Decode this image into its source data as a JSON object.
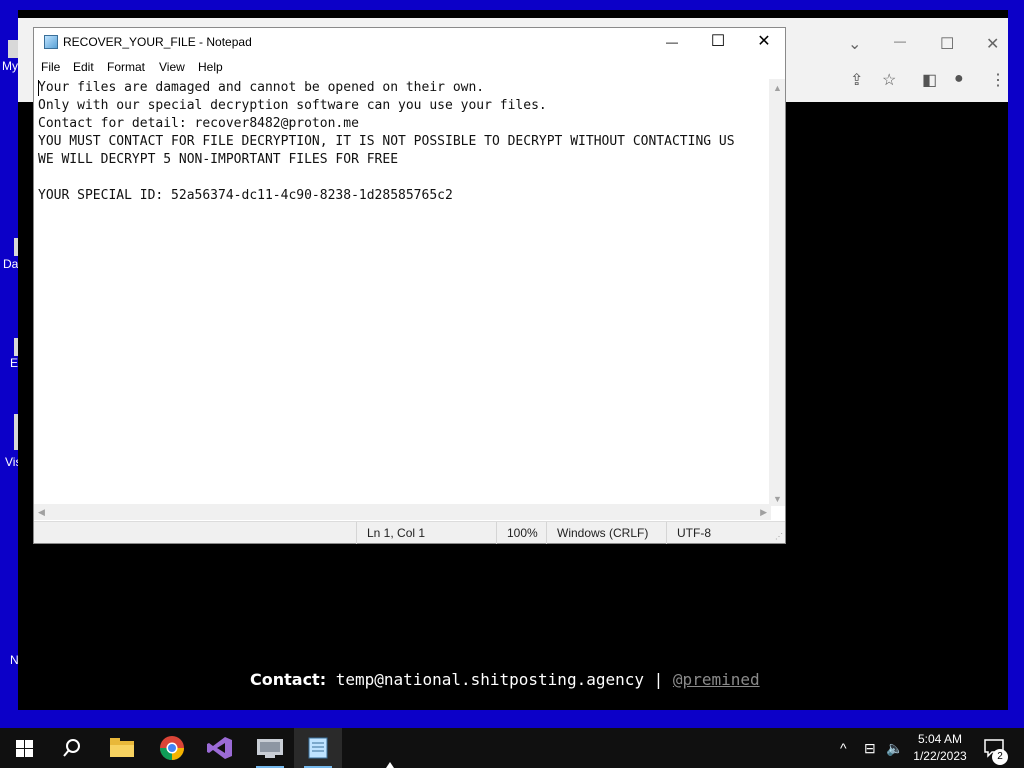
{
  "desktop": {
    "icons": [
      {
        "label": "My"
      },
      {
        "label": "Da"
      },
      {
        "label": "E"
      },
      {
        "label": "Vis"
      },
      {
        "label": "N"
      }
    ]
  },
  "browser": {
    "title_controls": {
      "chevron": "⌄",
      "minimize": "—",
      "maximize": "☐",
      "close": "✕"
    },
    "toolbar_icons": {
      "share": "⇪",
      "bookmark": "☆",
      "sidepanel": "◧",
      "profile": "●",
      "menu": "⋮"
    },
    "footer": {
      "label": "Contact:",
      "email": "temp@national.shitposting.agency",
      "separator": "|",
      "handle": "@premined"
    }
  },
  "notepad": {
    "title": "RECOVER_YOUR_FILE - Notepad",
    "controls": {
      "minimize": "—",
      "maximize": "☐",
      "close": "✕"
    },
    "menu": [
      "File",
      "Edit",
      "Format",
      "View",
      "Help"
    ],
    "lines": [
      "Your files are damaged and cannot be opened on their own.",
      "Only with our special decryption software can you use your files.",
      "Contact for detail: recover8482@proton.me",
      "YOU MUST CONTACT FOR FILE DECRYPTION, IT IS NOT POSSIBLE TO DECRYPT WITHOUT CONTACTING US",
      "WE WILL DECRYPT 5 NON-IMPORTANT FILES FOR FREE",
      "",
      "YOUR SPECIAL ID: 52a56374-dc11-4c90-8238-1d28585765c2"
    ],
    "status": {
      "position": "Ln 1, Col 1",
      "zoom": "100%",
      "line_ending": "Windows (CRLF)",
      "encoding": "UTF-8"
    }
  },
  "taskbar": {
    "apps": [
      {
        "name": "start",
        "icon": "windows-logo"
      },
      {
        "name": "search",
        "icon": "search-icon"
      },
      {
        "name": "file-explorer",
        "icon": "folder-icon"
      },
      {
        "name": "chrome",
        "icon": "chrome-icon"
      },
      {
        "name": "visual-studio",
        "icon": "visual-studio-icon"
      },
      {
        "name": "app",
        "icon": "app-icon"
      },
      {
        "name": "notepad",
        "icon": "notepad-icon"
      }
    ],
    "tray": {
      "chevron": "^",
      "network": "⊟",
      "volume": "🔈"
    },
    "clock": {
      "time": "5:04 AM",
      "date": "1/22/2023"
    },
    "notification_count": "2"
  },
  "colors": {
    "desktop_bg": "#0c00c8",
    "taskbar_bg": "#101010",
    "accent": "#76b9ed"
  }
}
